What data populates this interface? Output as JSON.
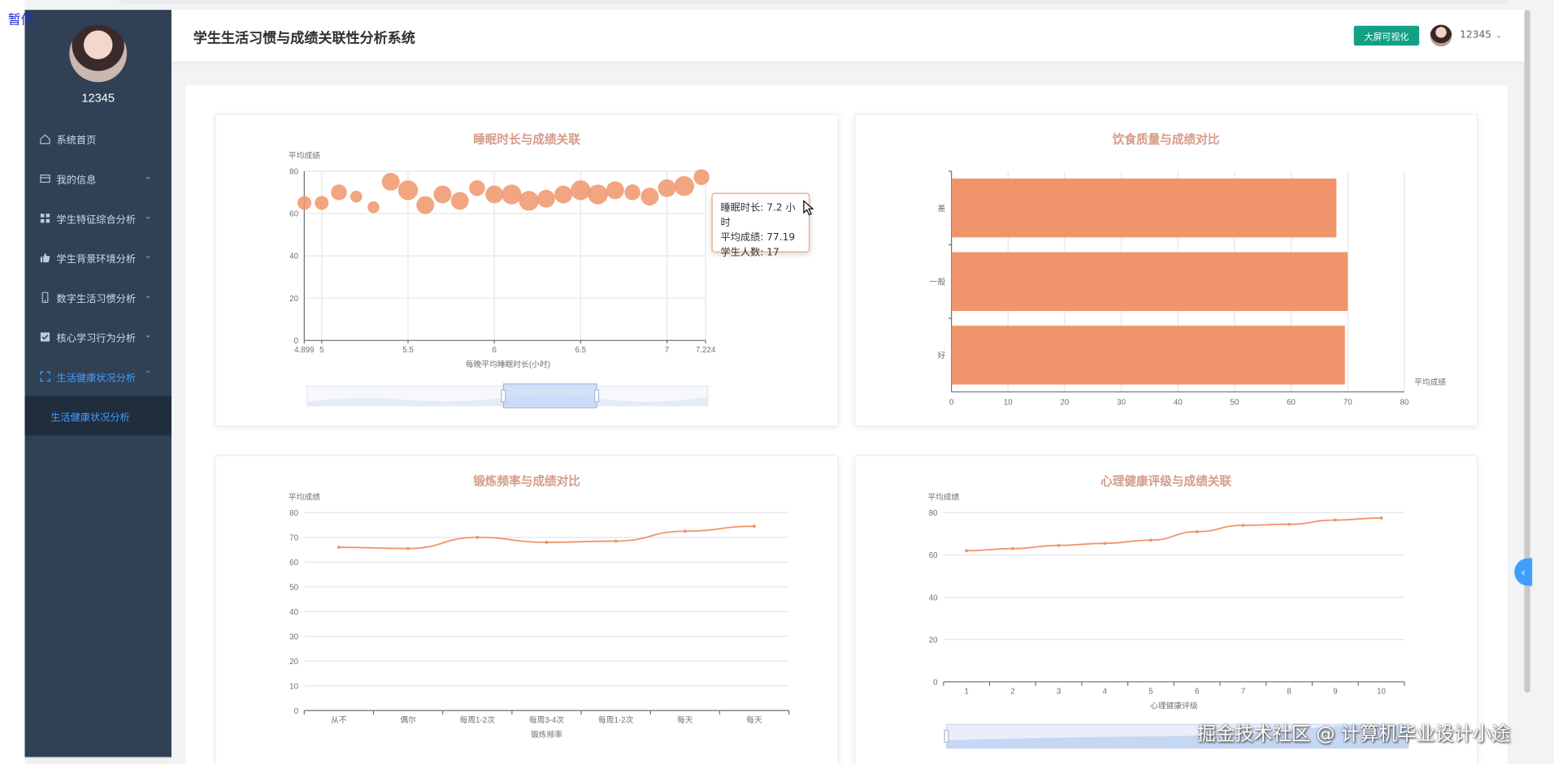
{
  "overlay_label": "暂停",
  "sidebar": {
    "username": "12345",
    "items": [
      {
        "label": "系统首页",
        "icon": "home-icon",
        "has_arrow": false
      },
      {
        "label": "我的信息",
        "icon": "profile-icon",
        "has_arrow": true
      },
      {
        "label": "学生特征综合分析",
        "icon": "grid-icon",
        "has_arrow": true
      },
      {
        "label": "学生背景环境分析",
        "icon": "thumb-icon",
        "has_arrow": true
      },
      {
        "label": "数字生活习惯分析",
        "icon": "phone-icon",
        "has_arrow": true
      },
      {
        "label": "核心学习行为分析",
        "icon": "check-icon",
        "has_arrow": true
      },
      {
        "label": "生活健康状况分析",
        "icon": "fullscreen-icon",
        "has_arrow": true,
        "active": true,
        "expanded": true
      }
    ],
    "submenu": [
      "生活健康状况分析"
    ]
  },
  "header": {
    "title": "学生生活习惯与成绩关联性分析系统",
    "bigscreen_label": "大屏可视化",
    "username": "12345"
  },
  "tooltip": {
    "line1": "睡眠时长: 7.2 小时",
    "line2": "平均成绩: 77.19",
    "line3": "学生人数: 17"
  },
  "watermark": "掘金技术社区 @ 计算机毕业设计小途",
  "theme": {
    "accent": "#409eff",
    "sidebar_bg": "#304156",
    "series_color": "#f0956b",
    "button_green": "#13a085",
    "title_color": "#d69c8a"
  },
  "chart_data": [
    {
      "type": "scatter",
      "title": "睡眠时长与成绩关联",
      "xlabel": "每晚平均睡眠时长(小时)",
      "ylabel": "平均成绩",
      "xlim": [
        4.899,
        7.224
      ],
      "ylim": [
        0,
        80
      ],
      "x_ticks": [
        "4.899",
        "5",
        "5.5",
        "6",
        "6.5",
        "7",
        "7.224"
      ],
      "y_ticks": [
        "0",
        "20",
        "40",
        "60",
        "80"
      ],
      "points": [
        {
          "x": 4.9,
          "y": 65,
          "size": 7
        },
        {
          "x": 5.0,
          "y": 65,
          "size": 7
        },
        {
          "x": 5.1,
          "y": 70,
          "size": 8
        },
        {
          "x": 5.2,
          "y": 68,
          "size": 6
        },
        {
          "x": 5.3,
          "y": 63,
          "size": 6
        },
        {
          "x": 5.4,
          "y": 75,
          "size": 9
        },
        {
          "x": 5.5,
          "y": 71,
          "size": 10
        },
        {
          "x": 5.6,
          "y": 64,
          "size": 9
        },
        {
          "x": 5.7,
          "y": 69,
          "size": 9
        },
        {
          "x": 5.8,
          "y": 66,
          "size": 9
        },
        {
          "x": 5.9,
          "y": 72,
          "size": 8
        },
        {
          "x": 6.0,
          "y": 69,
          "size": 9
        },
        {
          "x": 6.1,
          "y": 69,
          "size": 10
        },
        {
          "x": 6.2,
          "y": 66,
          "size": 10
        },
        {
          "x": 6.3,
          "y": 67,
          "size": 9
        },
        {
          "x": 6.4,
          "y": 69,
          "size": 9
        },
        {
          "x": 6.5,
          "y": 71,
          "size": 10
        },
        {
          "x": 6.6,
          "y": 69,
          "size": 10
        },
        {
          "x": 6.7,
          "y": 71,
          "size": 9
        },
        {
          "x": 6.8,
          "y": 70,
          "size": 8
        },
        {
          "x": 6.9,
          "y": 68,
          "size": 9
        },
        {
          "x": 7.0,
          "y": 72,
          "size": 9
        },
        {
          "x": 7.1,
          "y": 73,
          "size": 10
        },
        {
          "x": 7.2,
          "y": 77.19,
          "size": 8
        }
      ],
      "grid": true,
      "has_zoom_slider": true
    },
    {
      "type": "bar",
      "orientation": "horizontal",
      "title": "饮食质量与成绩对比",
      "categories": [
        "差",
        "一般",
        "好"
      ],
      "values": [
        68,
        70,
        69.5
      ],
      "xlabel": "平均成绩",
      "xlim": [
        0,
        80
      ],
      "x_ticks": [
        "0",
        "10",
        "20",
        "30",
        "40",
        "50",
        "60",
        "70",
        "80"
      ],
      "grid": true
    },
    {
      "type": "line",
      "title": "锻炼频率与成绩对比",
      "xlabel": "锻炼频率",
      "ylabel": "平均成绩",
      "categories": [
        "从不",
        "偶尔",
        "每周1-2次",
        "每周3-4次",
        "每周1-2次",
        "每天",
        "每天"
      ],
      "values": [
        66,
        65.5,
        70,
        68,
        68.5,
        72.5,
        74.5
      ],
      "ylim": [
        0,
        80
      ],
      "y_ticks": [
        "0",
        "10",
        "20",
        "30",
        "40",
        "50",
        "60",
        "70",
        "80"
      ],
      "grid": true
    },
    {
      "type": "line",
      "title": "心理健康评级与成绩关联",
      "xlabel": "心理健康评级",
      "ylabel": "平均成绩",
      "categories": [
        "1",
        "2",
        "3",
        "4",
        "5",
        "6",
        "7",
        "8",
        "9",
        "10"
      ],
      "values": [
        62,
        63,
        64.5,
        65.5,
        67,
        71,
        74,
        74.5,
        76.5,
        77.5
      ],
      "ylim": [
        0,
        80
      ],
      "y_ticks": [
        "0",
        "20",
        "40",
        "60",
        "80"
      ],
      "grid": true,
      "has_zoom_slider": true
    }
  ]
}
